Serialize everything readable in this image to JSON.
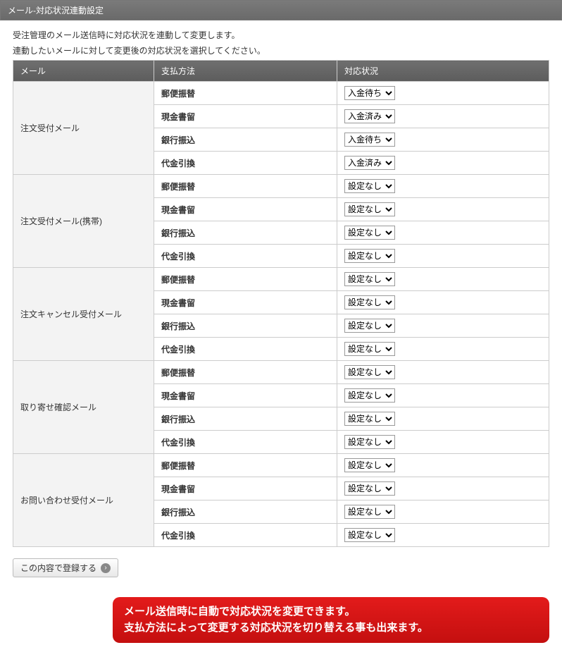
{
  "title": "メール-対応状況連動設定",
  "desc_line1": "受注管理のメール送信時に対応状況を連動して変更します。",
  "desc_line2": "連動したいメールに対して変更後の対応状況を選択してください。",
  "headers": {
    "mail": "メール",
    "pay": "支払方法",
    "status": "対応状況"
  },
  "payments": [
    "郵便振替",
    "現金書留",
    "銀行振込",
    "代金引換"
  ],
  "groups": [
    {
      "label": "注文受付メール",
      "statuses": [
        "入金待ち",
        "入金済み",
        "入金待ち",
        "入金済み"
      ]
    },
    {
      "label": "注文受付メール(携帯)",
      "statuses": [
        "設定なし",
        "設定なし",
        "設定なし",
        "設定なし"
      ]
    },
    {
      "label": "注文キャンセル受付メール",
      "statuses": [
        "設定なし",
        "設定なし",
        "設定なし",
        "設定なし"
      ]
    },
    {
      "label": "取り寄せ確認メール",
      "statuses": [
        "設定なし",
        "設定なし",
        "設定なし",
        "設定なし"
      ]
    },
    {
      "label": "お問い合わせ受付メール",
      "statuses": [
        "設定なし",
        "設定なし",
        "設定なし",
        "設定なし"
      ]
    }
  ],
  "status_options": [
    "設定なし",
    "入金待ち",
    "入金済み"
  ],
  "register_label": "この内容で登録する",
  "callout_line1": "メール送信時に自動で対応状況を変更できます。",
  "callout_line2": "支払方法によって変更する対応状況を切り替える事も出来ます。"
}
